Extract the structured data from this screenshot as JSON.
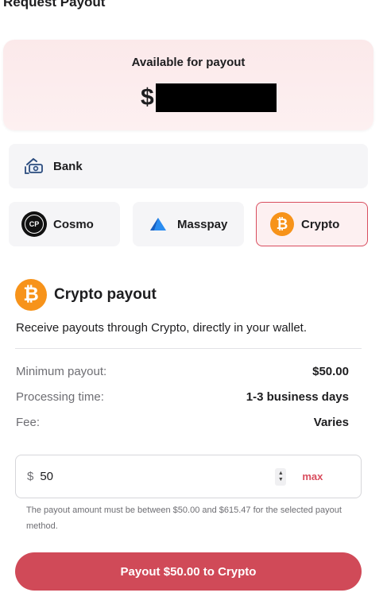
{
  "page": {
    "title": "Request Payout"
  },
  "balance": {
    "label": "Available for payout",
    "currency_symbol": "$"
  },
  "methods": {
    "bank": {
      "label": "Bank",
      "icon": "bank-icon"
    },
    "cosmo": {
      "label": "Cosmo",
      "icon": "cosmo-logo-icon",
      "icon_text": "CP"
    },
    "masspay": {
      "label": "Masspay",
      "icon": "masspay-logo-icon"
    },
    "crypto": {
      "label": "Crypto",
      "icon": "bitcoin-icon",
      "icon_text": "₿",
      "selected": true
    }
  },
  "crypto_section": {
    "title": "Crypto payout",
    "description": "Receive payouts through Crypto, directly in your wallet.",
    "rows": [
      {
        "key": "Minimum payout:",
        "value": "$50.00"
      },
      {
        "key": "Processing time:",
        "value": "1-3 business days"
      },
      {
        "key": "Fee:",
        "value": "Varies"
      }
    ]
  },
  "amount_field": {
    "currency": "$",
    "value": "50",
    "max_label": "max",
    "helper": "The payout amount must be between $50.00 and $615.47 for the selected payout method."
  },
  "submit": {
    "label": "Payout $50.00 to Crypto"
  },
  "colors": {
    "accent": "#d04a58",
    "bitcoin": "#f7931a",
    "masspay_blue": "#2a8cf0"
  }
}
